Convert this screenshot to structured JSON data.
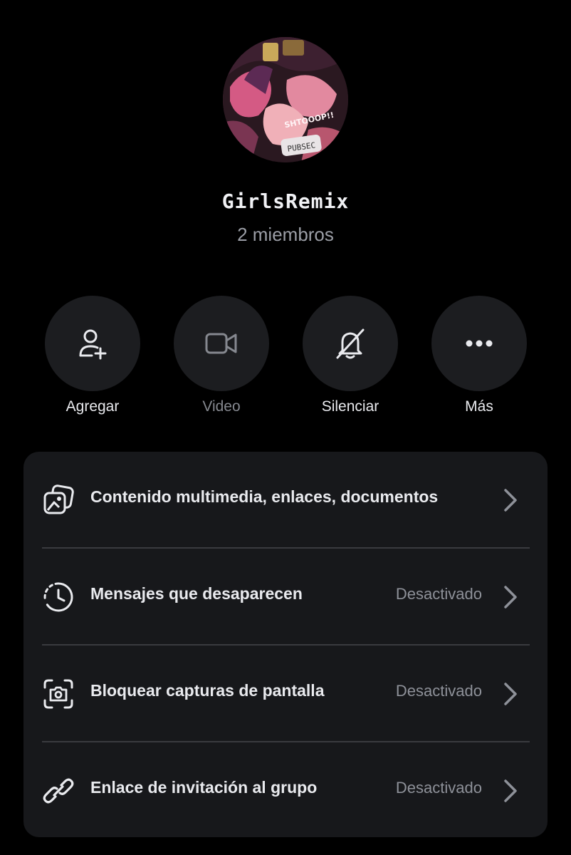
{
  "group": {
    "name": "GirlsRemix",
    "members": "2 miembros",
    "avatar_texts": [
      "SHTOOOP!!",
      "PUBSEC"
    ]
  },
  "actions": [
    {
      "label": "Agregar",
      "icon": "add-person-icon",
      "enabled": true
    },
    {
      "label": "Video",
      "icon": "video-camera-icon",
      "enabled": false
    },
    {
      "label": "Silenciar",
      "icon": "bell-off-icon",
      "enabled": true
    },
    {
      "label": "Más",
      "icon": "more-dots-icon",
      "enabled": true
    }
  ],
  "settings": [
    {
      "title": "Contenido multimedia, enlaces, documentos",
      "value": "",
      "icon": "media-gallery-icon"
    },
    {
      "title": "Mensajes que desaparecen",
      "value": "Desactivado",
      "icon": "timer-icon"
    },
    {
      "title": "Bloquear capturas de pantalla",
      "value": "Desactivado",
      "icon": "screenshot-icon"
    },
    {
      "title": "Enlace de invitación al grupo",
      "value": "Desactivado",
      "icon": "link-icon"
    }
  ],
  "colors": {
    "background": "#000000",
    "card": "#17181b",
    "circle_button": "#1c1d20",
    "text_primary": "#e9eaee",
    "text_secondary": "#9b9ea6",
    "divider": "#3a3b3f"
  }
}
